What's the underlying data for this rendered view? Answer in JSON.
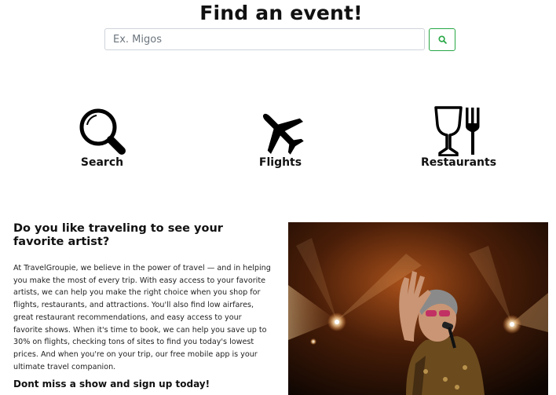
{
  "header": {
    "title": "Find an event!"
  },
  "search": {
    "placeholder": "Ex. Migos",
    "value": "",
    "button_icon": "search-icon",
    "accent": "#28a745"
  },
  "features": [
    {
      "label": "Search",
      "icon": "magnifier-icon"
    },
    {
      "label": "Flights",
      "icon": "airplane-icon"
    },
    {
      "label": "Restaurants",
      "icon": "cutlery-icon"
    }
  ],
  "about": {
    "heading": "Do you like traveling to see your favorite artist?",
    "body": "At TravelGroupie, we believe in the power of travel — and in helping you make the most of every trip. With easy access to your favorite artists, we can help you make the right choice when you shop for flights, restaurants, and attractions. You'll also find low airfares, great restaurant recommendations, and easy access to your favorite shows. When it's time to book, we can help you save up to 30% on flights, checking tons of sites to find you today's lowest prices. And when you're on your trip, our free mobile app is your ultimate travel companion.",
    "cta": "Dont miss a show and sign up today!"
  }
}
